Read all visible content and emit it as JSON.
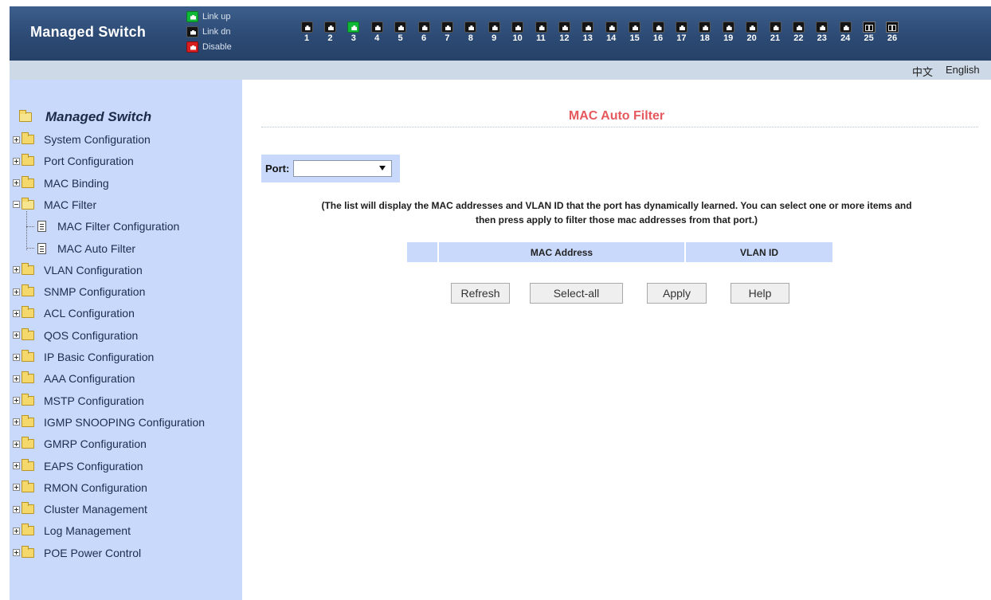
{
  "header": {
    "brand": "Managed Switch",
    "legend": [
      {
        "label": "Link up",
        "state": "up"
      },
      {
        "label": "Link dn",
        "state": "down"
      },
      {
        "label": "Disable",
        "state": "disabled"
      }
    ],
    "ports": [
      {
        "num": "1",
        "state": "down",
        "type": "rj45"
      },
      {
        "num": "2",
        "state": "down",
        "type": "rj45"
      },
      {
        "num": "3",
        "state": "up",
        "type": "rj45"
      },
      {
        "num": "4",
        "state": "down",
        "type": "rj45"
      },
      {
        "num": "5",
        "state": "down",
        "type": "rj45"
      },
      {
        "num": "6",
        "state": "down",
        "type": "rj45"
      },
      {
        "num": "7",
        "state": "down",
        "type": "rj45"
      },
      {
        "num": "8",
        "state": "down",
        "type": "rj45"
      },
      {
        "num": "9",
        "state": "down",
        "type": "rj45"
      },
      {
        "num": "10",
        "state": "down",
        "type": "rj45"
      },
      {
        "num": "11",
        "state": "down",
        "type": "rj45"
      },
      {
        "num": "12",
        "state": "down",
        "type": "rj45"
      },
      {
        "num": "13",
        "state": "down",
        "type": "rj45"
      },
      {
        "num": "14",
        "state": "down",
        "type": "rj45"
      },
      {
        "num": "15",
        "state": "down",
        "type": "rj45"
      },
      {
        "num": "16",
        "state": "down",
        "type": "rj45"
      },
      {
        "num": "17",
        "state": "down",
        "type": "rj45"
      },
      {
        "num": "18",
        "state": "down",
        "type": "rj45"
      },
      {
        "num": "19",
        "state": "down",
        "type": "rj45"
      },
      {
        "num": "20",
        "state": "down",
        "type": "rj45"
      },
      {
        "num": "21",
        "state": "down",
        "type": "rj45"
      },
      {
        "num": "22",
        "state": "down",
        "type": "rj45"
      },
      {
        "num": "23",
        "state": "down",
        "type": "rj45"
      },
      {
        "num": "24",
        "state": "down",
        "type": "rj45"
      },
      {
        "num": "25",
        "state": "down",
        "type": "sfp"
      },
      {
        "num": "26",
        "state": "down",
        "type": "sfp"
      }
    ]
  },
  "language": {
    "chinese": "中文",
    "english": "English"
  },
  "sidebar": {
    "root": "Managed Switch",
    "items": [
      {
        "label": "System Configuration"
      },
      {
        "label": "Port Configuration"
      },
      {
        "label": "MAC Binding"
      },
      {
        "label": "MAC Filter",
        "expanded": true,
        "children": [
          "MAC Filter Configuration",
          "MAC Auto Filter"
        ]
      },
      {
        "label": "VLAN Configuration"
      },
      {
        "label": "SNMP Configuration"
      },
      {
        "label": "ACL Configuration"
      },
      {
        "label": "QOS Configuration"
      },
      {
        "label": "IP Basic Configuration"
      },
      {
        "label": "AAA Configuration"
      },
      {
        "label": "MSTP Configuration"
      },
      {
        "label": "IGMP SNOOPING Configuration"
      },
      {
        "label": "GMRP Configuration"
      },
      {
        "label": "EAPS Configuration"
      },
      {
        "label": "RMON Configuration"
      },
      {
        "label": "Cluster Management"
      },
      {
        "label": "Log Management"
      },
      {
        "label": "POE Power Control"
      }
    ]
  },
  "main": {
    "title": "MAC Auto Filter",
    "port_label": "Port:",
    "port_value": "",
    "note_line1": "(The list will display the MAC addresses and VLAN ID that the port has dynamically learned. You can select one or more items and",
    "note_line2": "then press apply to filter those mac addresses from that port.)",
    "table_headers": [
      "",
      "MAC Address",
      "VLAN ID"
    ],
    "buttons": {
      "refresh": "Refresh",
      "select_all": "Select-all",
      "apply": "Apply",
      "help": "Help"
    }
  },
  "colors": {
    "header_bg": "#2c4a74",
    "sidebar_bg": "#c8d9fb",
    "title_red": "#e5595e",
    "link_up": "#10b838",
    "link_down": "#141414",
    "disabled": "#d81f1f"
  }
}
